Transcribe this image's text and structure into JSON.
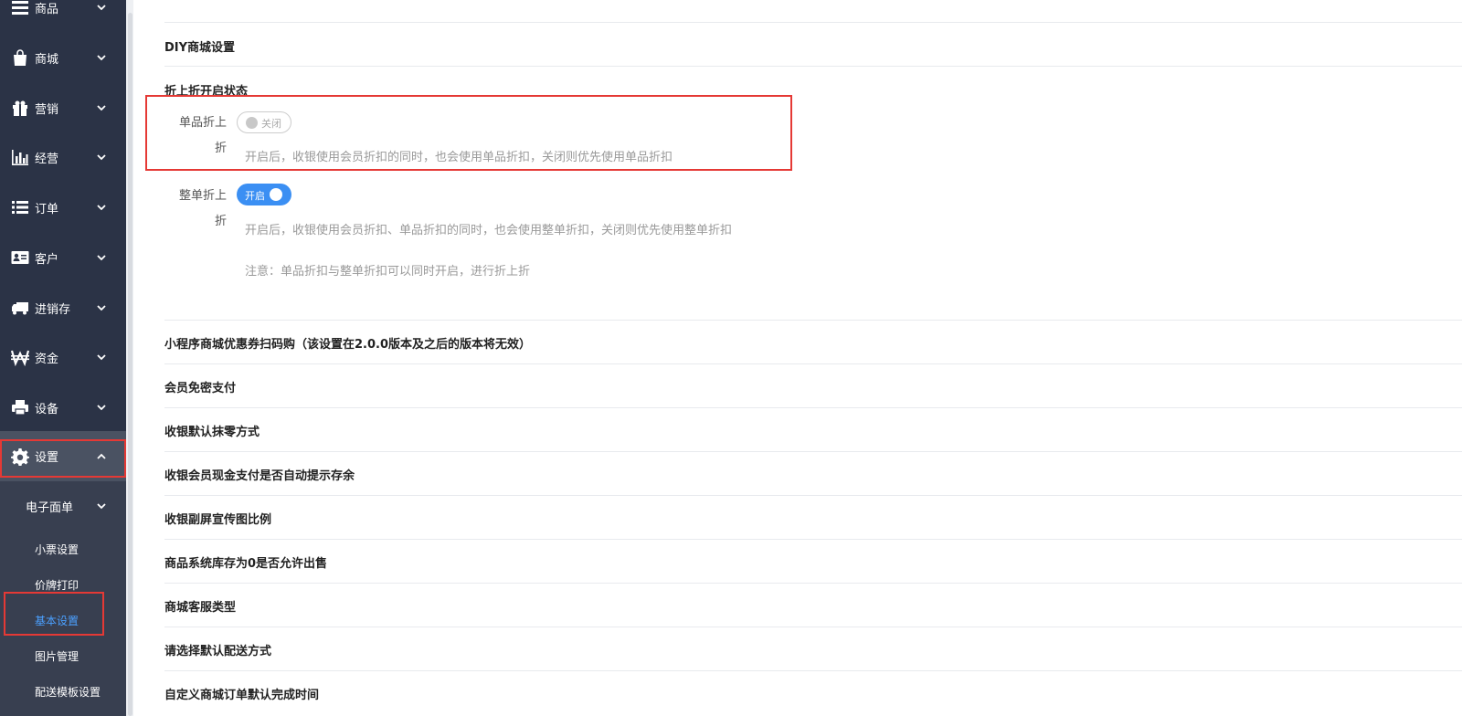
{
  "sidebar": {
    "items": [
      {
        "label": "商品",
        "icon": "list-icon"
      },
      {
        "label": "商城",
        "icon": "shopping-bag-icon"
      },
      {
        "label": "营销",
        "icon": "gift-icon"
      },
      {
        "label": "经营",
        "icon": "bar-chart-icon"
      },
      {
        "label": "订单",
        "icon": "list-icon"
      },
      {
        "label": "客户",
        "icon": "id-card-icon"
      },
      {
        "label": "进销存",
        "icon": "truck-icon"
      },
      {
        "label": "资金",
        "icon": "won-icon"
      },
      {
        "label": "设备",
        "icon": "printer-icon"
      },
      {
        "label": "设置",
        "icon": "gear-icon"
      }
    ],
    "sub_group": "电子面单",
    "sub_items": [
      "小票设置",
      "价牌打印",
      "基本设置",
      "图片管理",
      "配送模板设置"
    ]
  },
  "main": {
    "sections": {
      "diy": "DIY商城设置",
      "discount": "折上折开启状态",
      "coupon_scan": "小程序商城优惠券扫码购（该设置在2.0.0版本及之后的版本将无效）",
      "member_pay": "会员免密支付",
      "rounding": "收银默认抹零方式",
      "cash_prompt": "收银会员现金支付是否自动提示存余",
      "screen_ratio": "收银副屏宣传图比例",
      "zero_stock": "商品系统库存为0是否允许出售",
      "cs_type": "商城客服类型",
      "delivery": "请选择默认配送方式",
      "order_time": "自定义商城订单默认完成时间"
    },
    "single": {
      "label_1": "单品折上",
      "label_2": "折",
      "switch_text": "关闭",
      "state": "off",
      "hint": "开启后，收银使用会员折扣的同时，也会使用单品折扣，关闭则优先使用单品折扣"
    },
    "whole": {
      "label_1": "整单折上",
      "label_2": "折",
      "switch_text": "开启",
      "state": "on",
      "hint": "开启后，收银使用会员折扣、单品折扣的同时，也会使用整单折扣，关闭则优先使用整单折扣",
      "note": "注意：单品折扣与整单折扣可以同时开启，进行折上折"
    }
  },
  "colors": {
    "sidebar_bg": "#2b3346",
    "accent": "#3b8ff3",
    "highlight_border": "#e53935",
    "active_link": "#4ba0ff"
  }
}
